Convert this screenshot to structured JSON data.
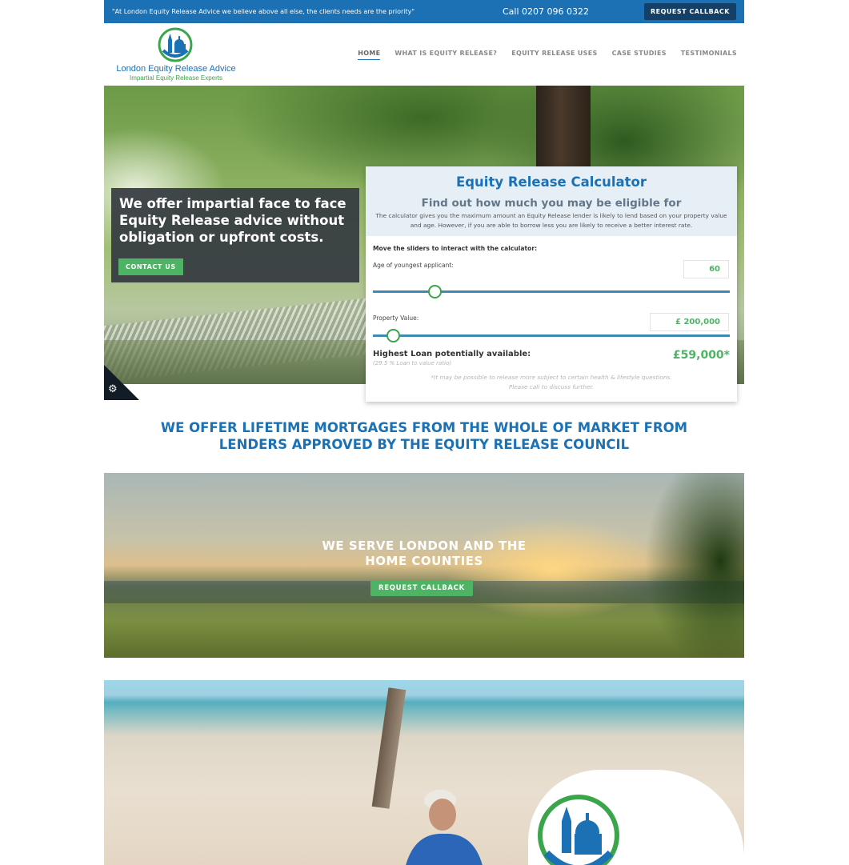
{
  "topbar": {
    "quote": "\"At London Equity Release Advice we believe above all else, the clients needs are the priority\"",
    "phone": "Call 0207 096 0322",
    "callback_label": "REQUEST CALLBACK"
  },
  "brand": {
    "name": "London Equity Release Advice",
    "tagline": "Impartial Equity Release Experts"
  },
  "nav": {
    "items": [
      {
        "label": "HOME",
        "active": true
      },
      {
        "label": "WHAT IS EQUITY RELEASE?"
      },
      {
        "label": "EQUITY RELEASE USES"
      },
      {
        "label": "CASE STUDIES"
      },
      {
        "label": "TESTIMONIALS"
      }
    ]
  },
  "hero": {
    "headline": "We offer impartial face to face Equity Release advice without obligation or upfront costs.",
    "contact_label": "CONTACT US"
  },
  "calculator": {
    "title": "Equity Release Calculator",
    "subtitle": "Find out how much you may be eligible for",
    "description": "The calculator gives you the maximum amount an Equity Release lender is likely to lend based on your property value and age. However, if you are able to borrow less you are likely to receive a better interest rate.",
    "instructions": "Move the sliders to interact with the calculator:",
    "age_label": "Age of youngest applicant:",
    "age_value": "60",
    "property_label": "Property Value:",
    "property_value": "£ 200,000",
    "result_label": "Highest Loan potentially available:",
    "ratio_text": "(29.5 % Loan to value ratio)",
    "result_value": "£59,000*",
    "note_line1": "*It may be possible to release more subject to certain health & lifestyle questions.",
    "note_line2": "Please call to discuss further.",
    "age_slider_fraction": 0.16,
    "property_slider_fraction": 0.04
  },
  "headline": {
    "line1": "WE OFFER LIFETIME MORTGAGES FROM THE WHOLE OF MARKET FROM",
    "line2": "LENDERS APPROVED BY THE EQUITY RELEASE COUNCIL"
  },
  "banner": {
    "line1": "WE SERVE LONDON AND THE",
    "line2": "HOME COUNTIES",
    "button_label": "REQUEST CALLBACK"
  },
  "colors": {
    "primary_blue": "#1b71b3",
    "accent_green": "#4fb365",
    "dark_navy": "#143f66"
  },
  "icons": {
    "cookie": "gear-icon"
  }
}
